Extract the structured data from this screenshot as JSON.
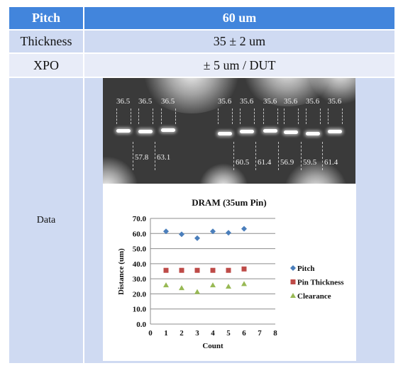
{
  "table": {
    "header": {
      "label": "Pitch",
      "value": "60 um"
    },
    "rows": [
      {
        "label": "Thickness",
        "value": "35 ± 2 um"
      },
      {
        "label": "XPO",
        "value": "± 5 um / DUT"
      },
      {
        "label": "Data"
      }
    ]
  },
  "photo": {
    "thickness_labels": [
      "36.5",
      "36.5",
      "36.5",
      "35.6",
      "35.6",
      "35.6",
      "35.6",
      "35.6",
      "35.6"
    ],
    "pitch_labels": [
      "57.8",
      "63.1",
      "60.5",
      "61.4",
      "56.9",
      "59.5",
      "61.4"
    ]
  },
  "chart_data": {
    "type": "scatter",
    "title": "DRAM (35um Pin)",
    "xlabel": "Count",
    "ylabel": "Distance (um)",
    "xlim": [
      0,
      8
    ],
    "ylim": [
      0,
      70
    ],
    "xticks": [
      "0",
      "1",
      "2",
      "3",
      "4",
      "5",
      "6",
      "7",
      "8"
    ],
    "yticks": [
      "0.0",
      "10.0",
      "20.0",
      "30.0",
      "40.0",
      "50.0",
      "60.0",
      "70.0"
    ],
    "grid": "horizontal",
    "legend_position": "right",
    "x": [
      1,
      2,
      3,
      4,
      5,
      6
    ],
    "series": [
      {
        "name": "Pitch",
        "marker": "diamond",
        "color": "#4a7ebb",
        "values": [
          61.4,
          59.5,
          56.9,
          61.4,
          60.5,
          63.1
        ]
      },
      {
        "name": "Pin Thickness",
        "marker": "square",
        "color": "#be4b48",
        "values": [
          35.6,
          35.6,
          35.6,
          35.6,
          35.6,
          36.5
        ]
      },
      {
        "name": "Clearance",
        "marker": "triangle",
        "color": "#98b954",
        "values": [
          25.8,
          23.9,
          21.3,
          25.8,
          24.9,
          26.6
        ]
      }
    ]
  }
}
